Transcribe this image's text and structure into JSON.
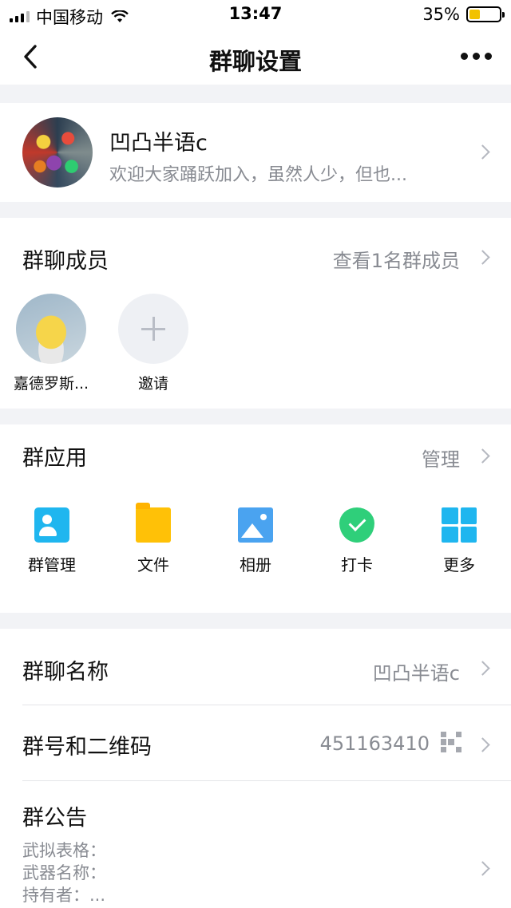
{
  "status_bar": {
    "carrier": "中国移动",
    "time": "13:47",
    "battery_percent": "35%",
    "battery_level": 0.35
  },
  "nav": {
    "title": "群聊设置",
    "back_icon": "chevron-left-icon",
    "more_icon": "more-dots-icon"
  },
  "group": {
    "name": "凹凸半语c",
    "description": "欢迎大家踊跃加入，虽然人少，但也..."
  },
  "members": {
    "title": "群聊成员",
    "view_all": "查看1名群成员",
    "list": [
      {
        "name": "嘉德罗斯..."
      }
    ],
    "invite_label": "邀请"
  },
  "apps": {
    "title": "群应用",
    "manage": "管理",
    "items": [
      {
        "label": "群管理",
        "icon": "group-manage-icon",
        "color": "#1fb6ef"
      },
      {
        "label": "文件",
        "icon": "folder-icon",
        "color": "#ffc107"
      },
      {
        "label": "相册",
        "icon": "album-icon",
        "color": "#4aa3f0"
      },
      {
        "label": "打卡",
        "icon": "checkin-icon",
        "color": "#2fcf7a"
      },
      {
        "label": "更多",
        "icon": "more-grid-icon",
        "color": "#1fb6ef"
      }
    ]
  },
  "settings": {
    "name_label": "群聊名称",
    "name_value": "凹凸半语c",
    "number_label": "群号和二维码",
    "number_value": "451163410",
    "notice_label": "群公告",
    "notice_lines": [
      "武拟表格：",
      "武器名称：",
      "持有者：..."
    ]
  }
}
